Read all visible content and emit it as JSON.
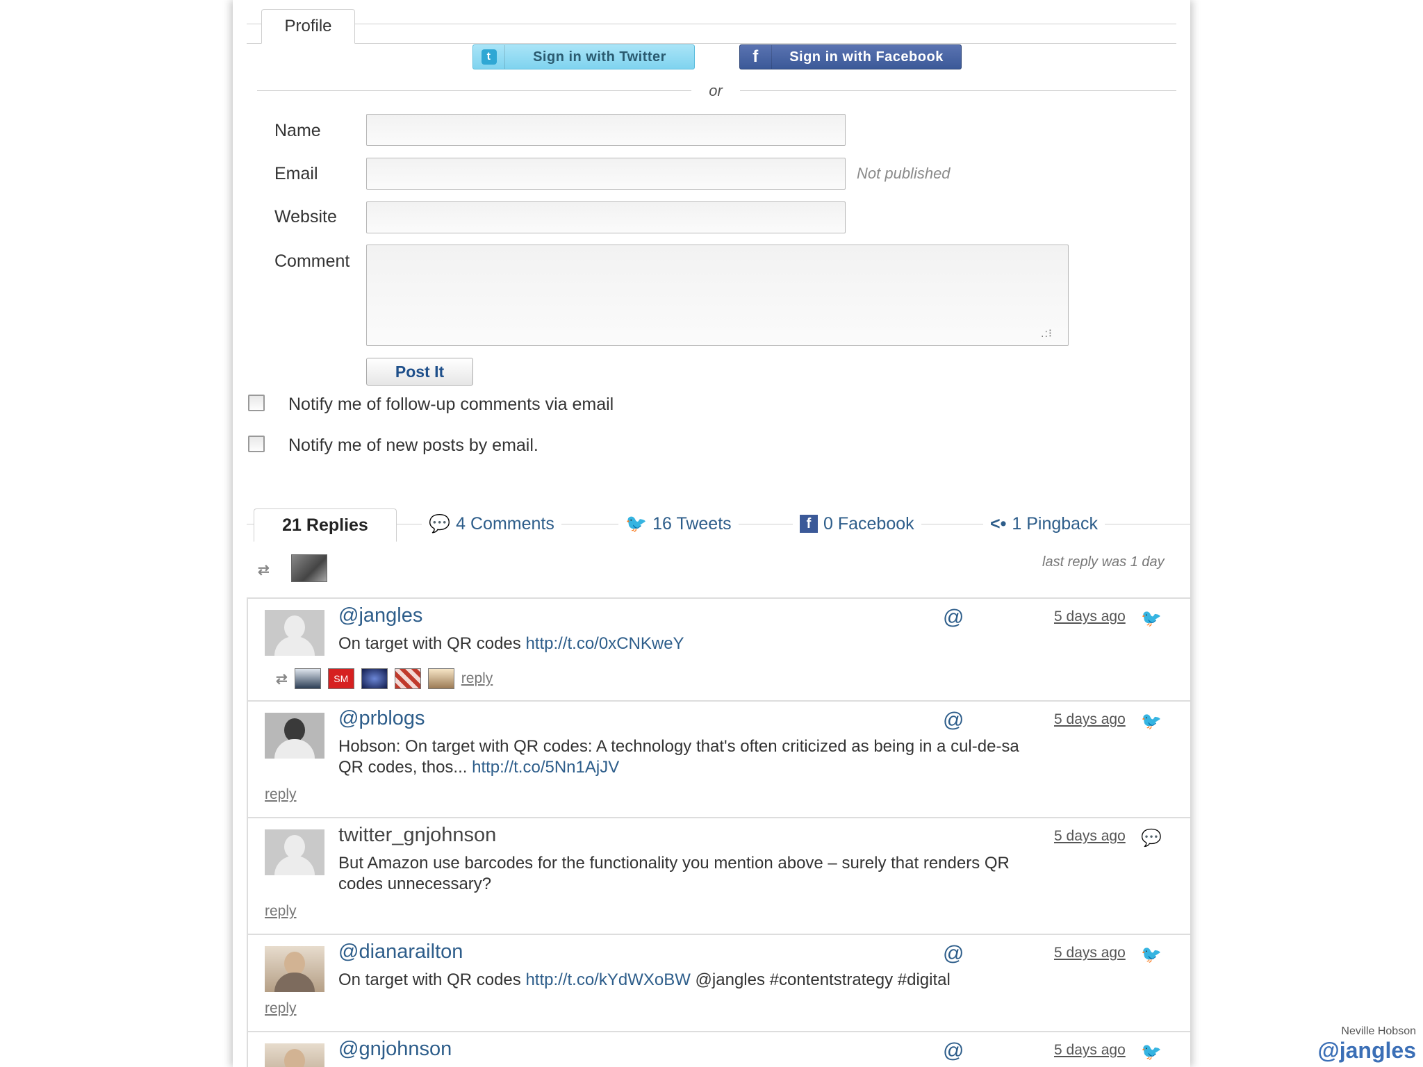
{
  "profile": {
    "tab_label": "Profile"
  },
  "social": {
    "twitter_label": "Sign in with Twitter",
    "facebook_label": "Sign in with Facebook",
    "or_text": "or"
  },
  "form": {
    "name_label": "Name",
    "email_label": "Email",
    "website_label": "Website",
    "comment_label": "Comment",
    "name_value": "",
    "email_value": "",
    "website_value": "",
    "comment_value": "",
    "email_hint": "Not published",
    "post_button": "Post It",
    "notify_followup": "Notify me of follow-up comments via email",
    "notify_posts": "Notify me of new posts by email."
  },
  "tabs": {
    "replies": "21 Replies",
    "comments": "4 Comments",
    "tweets": "16 Tweets",
    "facebook": "0 Facebook",
    "pingback": "1 Pingback"
  },
  "last_reply": "last reply was 1 day",
  "replies": [
    {
      "author": "@jangles",
      "at": "@",
      "time": "5 days ago",
      "text": "On target with QR codes",
      "link": "http://t.co/0xCNKweY",
      "reply_label": "reply"
    },
    {
      "author": "@prblogs",
      "at": "@",
      "time": "5 days ago",
      "text_line1": "Hobson: On target with QR codes: A technology that's often criticized as being in a cul-de-sa",
      "text_line2": "QR codes, thos...",
      "link": "http://t.co/5Nn1AjJV",
      "reply_label": "reply"
    },
    {
      "author": "twitter_gnjohnson",
      "time": "5 days ago",
      "text_line1": "But Amazon use barcodes for the functionality you mention above – surely that renders QR",
      "text_line2": "codes unnecessary?",
      "reply_label": "reply"
    },
    {
      "author": "@dianarailton",
      "at": "@",
      "time": "5 days ago",
      "text": "On target with QR codes",
      "link": "http://t.co/kYdWXoBW",
      "text_after": "@jangles #contentstrategy #digital",
      "reply_label": "reply"
    },
    {
      "author": "@gnjohnson",
      "at": "@",
      "time": "5 days ago"
    }
  ],
  "footer": {
    "name": "Neville Hobson",
    "handle": "@jangles"
  },
  "colors": {
    "link": "#2d5d8a",
    "twitter": "#3ab0e2",
    "facebook": "#3b5998"
  }
}
